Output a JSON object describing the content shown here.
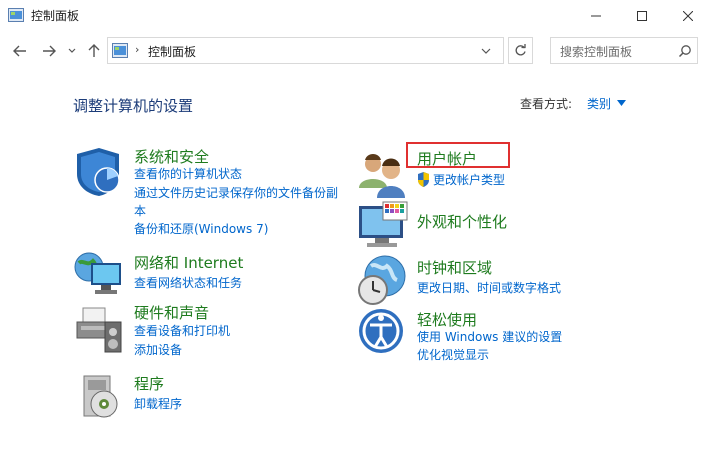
{
  "window": {
    "title": "控制面板",
    "minimize": "minimize",
    "maximize": "maximize",
    "close": "close"
  },
  "address": {
    "path": "控制面板",
    "separator": "›"
  },
  "search": {
    "placeholder": "搜索控制面板"
  },
  "main": {
    "heading": "调整计算机的设置",
    "view_by_label": "查看方式:",
    "view_by_value": "类别"
  },
  "categories_left": [
    {
      "title": "系统和安全",
      "links": [
        "查看你的计算机状态",
        "通过文件历史记录保存你的文件备份副",
        "本",
        "备份和还原(Windows 7)"
      ]
    },
    {
      "title": "网络和 Internet",
      "links": [
        "查看网络状态和任务"
      ]
    },
    {
      "title": "硬件和声音",
      "links": [
        "查看设备和打印机",
        "添加设备"
      ]
    },
    {
      "title": "程序",
      "links": [
        "卸载程序"
      ]
    }
  ],
  "categories_right": [
    {
      "title": "用户帐户",
      "links": [
        "更改帐户类型"
      ]
    },
    {
      "title": "外观和个性化",
      "links": []
    },
    {
      "title": "时钟和区域",
      "links": [
        "更改日期、时间或数字格式"
      ]
    },
    {
      "title": "轻松使用",
      "links": [
        "使用 Windows 建议的设置",
        "优化视觉显示"
      ]
    }
  ],
  "colors": {
    "category_title": "#1e7b1e",
    "link": "#0066cc",
    "heading": "#1c3c79",
    "highlight_border": "#e03030"
  }
}
